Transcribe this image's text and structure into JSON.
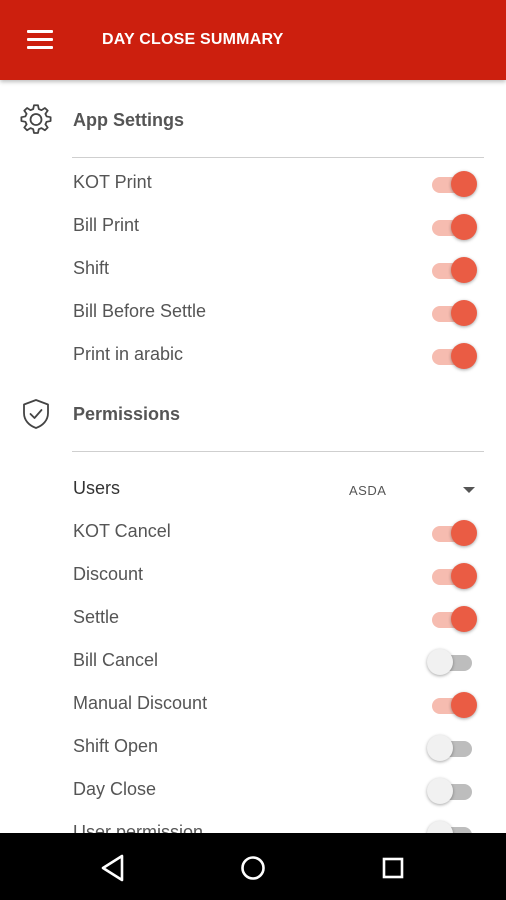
{
  "toolbar": {
    "title": "DAY CLOSE SUMMARY",
    "menu_icon": "hamburger-menu-icon"
  },
  "app_settings": {
    "title": "App Settings",
    "icon": "gear-icon",
    "items": [
      {
        "label": "KOT Print",
        "enabled": true
      },
      {
        "label": "Bill Print",
        "enabled": true
      },
      {
        "label": "Shift",
        "enabled": true
      },
      {
        "label": "Bill Before Settle",
        "enabled": true
      },
      {
        "label": "Print in arabic",
        "enabled": true
      }
    ]
  },
  "permissions": {
    "title": "Permissions",
    "icon": "shield-check-icon",
    "users_label": "Users",
    "users_selected": "ASDA",
    "items": [
      {
        "label": "KOT Cancel",
        "enabled": true
      },
      {
        "label": "Discount",
        "enabled": true
      },
      {
        "label": "Settle",
        "enabled": true
      },
      {
        "label": "Bill Cancel",
        "enabled": false
      },
      {
        "label": "Manual Discount",
        "enabled": true
      },
      {
        "label": "Shift Open",
        "enabled": false
      },
      {
        "label": "Day Close",
        "enabled": false
      },
      {
        "label": "User permission",
        "enabled": false
      }
    ]
  },
  "colors": {
    "app_bar": "#cc1f0e",
    "toggle_on": "#ea5c44",
    "toggle_on_track": "#f6bcb0",
    "toggle_off": "#f1f1f1",
    "toggle_off_track": "#bdbdbd"
  },
  "nav_bar": {
    "back_icon": "back-triangle-icon",
    "home_icon": "home-circle-icon",
    "recent_icon": "recent-apps-square-icon"
  }
}
